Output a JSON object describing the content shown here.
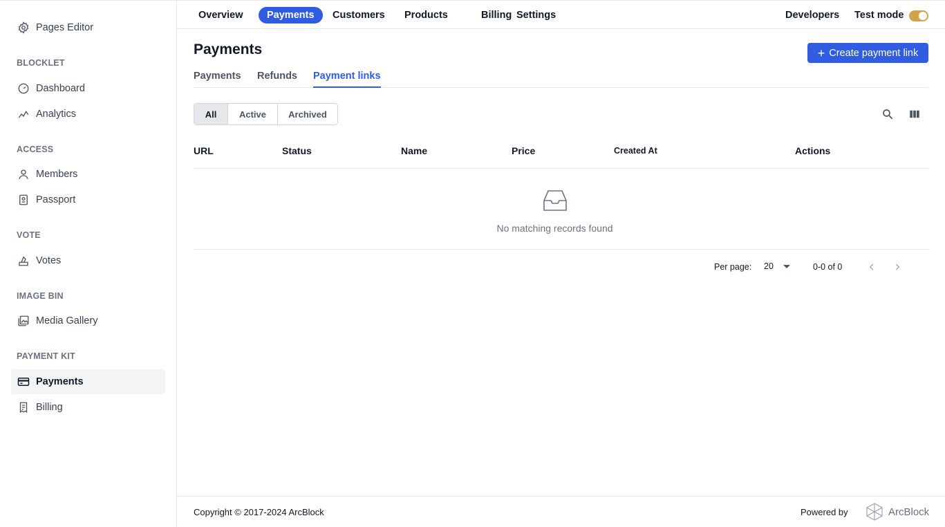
{
  "sidebar": {
    "top_item": {
      "label": "Pages Editor",
      "icon": "gear-icon"
    },
    "sections": [
      {
        "heading": "BLOCKLET",
        "items": [
          {
            "label": "Dashboard",
            "icon": "dashboard-icon"
          },
          {
            "label": "Analytics",
            "icon": "analytics-icon"
          }
        ]
      },
      {
        "heading": "ACCESS",
        "items": [
          {
            "label": "Members",
            "icon": "user-icon"
          },
          {
            "label": "Passport",
            "icon": "passport-icon"
          }
        ]
      },
      {
        "heading": "VOTE",
        "items": [
          {
            "label": "Votes",
            "icon": "vote-icon"
          }
        ]
      },
      {
        "heading": "IMAGE BIN",
        "items": [
          {
            "label": "Media Gallery",
            "icon": "image-icon"
          }
        ]
      },
      {
        "heading": "PAYMENT KIT",
        "items": [
          {
            "label": "Payments",
            "icon": "credit-card-icon",
            "active": true
          },
          {
            "label": "Billing",
            "icon": "receipt-icon"
          }
        ]
      }
    ]
  },
  "topnav": {
    "items": [
      "Overview",
      "Payments",
      "Customers",
      "Products",
      "Billing",
      "Settings"
    ],
    "active": "Payments",
    "developers": "Developers",
    "test_mode": "Test mode",
    "test_mode_on": true,
    "toggle_color": "#d4a24a"
  },
  "main": {
    "title": "Payments",
    "create_button": "Create payment link",
    "subtabs": [
      "Payments",
      "Refunds",
      "Payment links"
    ],
    "active_subtab": "Payment links",
    "filters": [
      "All",
      "Active",
      "Archived"
    ],
    "active_filter": "All",
    "columns": [
      "URL",
      "Status",
      "Name",
      "Price",
      "Created At",
      "Actions"
    ],
    "empty_message": "No matching records found",
    "pager": {
      "label": "Per page:",
      "per_page": "20",
      "range": "0-0 of 0"
    }
  },
  "footer": {
    "copyright": "Copyright © 2017-2024  ArcBlock",
    "powered_by": "Powered by",
    "brand": "ArcBlock"
  },
  "colors": {
    "accent": "#2f5ce1",
    "border": "#e5e7eb"
  }
}
